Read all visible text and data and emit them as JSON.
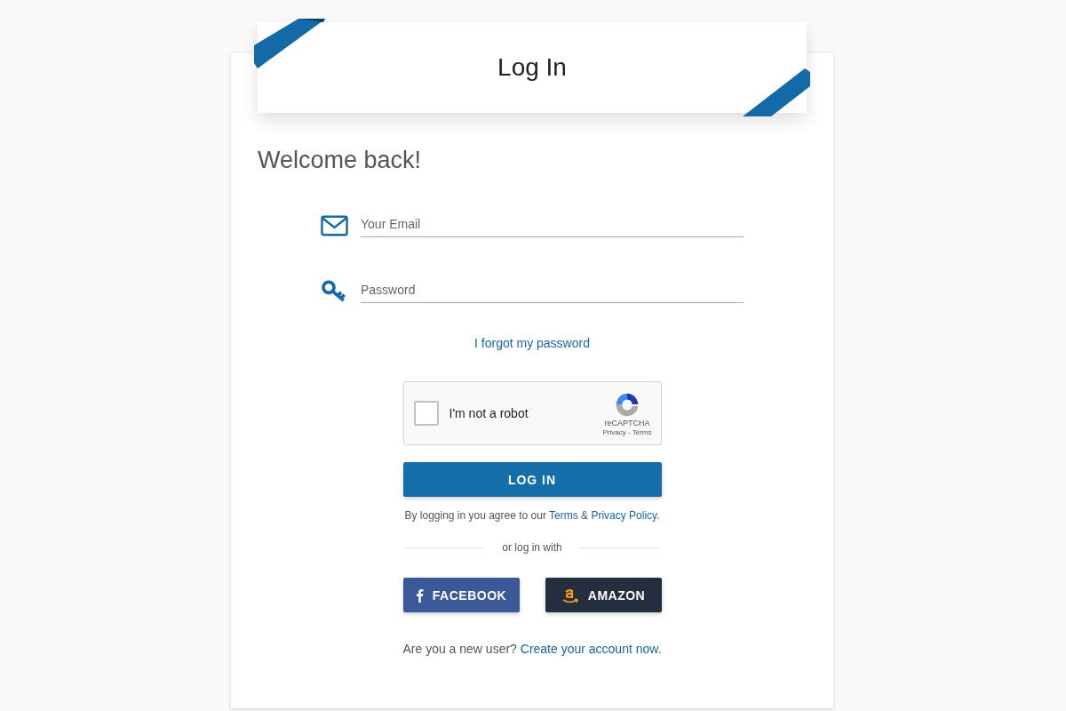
{
  "header": {
    "title": "Log In"
  },
  "greeting": "Welcome back!",
  "fields": [
    {
      "kind": "email",
      "placeholder": "Your Email"
    },
    {
      "kind": "password",
      "placeholder": "Password"
    }
  ],
  "forgot_link": "I forgot my password",
  "captcha": {
    "label": "I'm not a robot",
    "checked": false,
    "brand": "reCAPTCHA",
    "links": "Privacy - Terms"
  },
  "login_button": "LOG IN",
  "agreement": {
    "before": "By logging in you agree to our ",
    "terms": "Terms",
    "between": " & ",
    "privacy": "Privacy Policy",
    "after": "."
  },
  "divider": "or log in with",
  "social": [
    {
      "kind": "facebook",
      "label": "FACEBOOK"
    },
    {
      "kind": "amazon",
      "label": "AMAZON"
    }
  ],
  "signup": {
    "question": "Are you a new user? ",
    "link": "Create your account now",
    "after": "."
  }
}
